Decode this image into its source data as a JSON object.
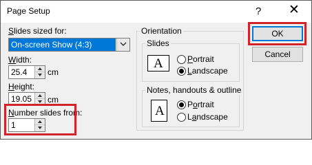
{
  "window": {
    "title": "Page Setup",
    "help_glyph": "?",
    "close_glyph": "✕"
  },
  "slides_sized_for": {
    "label_u": "S",
    "label_rest": "lides sized for:",
    "selected": "On-screen Show (4:3)"
  },
  "width": {
    "label_u": "W",
    "label_rest": "idth:",
    "value": "25.4",
    "unit": "cm"
  },
  "height": {
    "label_u": "H",
    "label_rest": "eight:",
    "value": "19.05",
    "unit": "cm"
  },
  "number_slides_from": {
    "label_u": "N",
    "label_rest": "umber slides from:",
    "value": "1"
  },
  "orientation": {
    "title": "Orientation",
    "slides": {
      "title": "Slides",
      "icon_letter": "A",
      "portrait_u": "P",
      "portrait_rest": "ortrait",
      "landscape_u": "L",
      "landscape_rest": "andscape",
      "selected": "landscape"
    },
    "notes": {
      "title": "Notes, handouts & outline",
      "icon_letter": "A",
      "portrait_pre": "P",
      "portrait_u": "o",
      "portrait_rest": "rtrait",
      "landscape_pre": "L",
      "landscape_u": "a",
      "landscape_rest": "ndscape",
      "selected": "portrait"
    }
  },
  "buttons": {
    "ok": "OK",
    "cancel": "Cancel"
  },
  "colors": {
    "highlight": "#d0232a",
    "selection": "#0078d7"
  }
}
